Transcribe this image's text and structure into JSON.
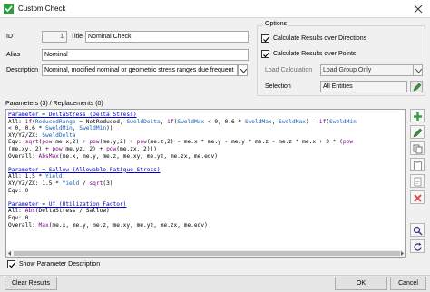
{
  "window": {
    "title": "Custom Check",
    "colors": {
      "accent": "#2e7d32",
      "icon": "#2e9e3e"
    }
  },
  "form": {
    "id_label": "ID",
    "id_value": "1",
    "title_label": "Title",
    "title_value": "Nominal Check",
    "alias_label": "Alias",
    "alias_value": "Nominal",
    "description_label": "Description",
    "description_value": "Nominal, modified nominal or geometric stress ranges due frequent"
  },
  "options": {
    "group_title": "Options",
    "calc_directions_label": "Calculate Results over Directions",
    "calc_directions_checked": true,
    "calc_points_label": "Calculate Results over Points",
    "calc_points_checked": true,
    "load_calc_label": "Load Calculation",
    "load_calc_value": "Load Group Only",
    "selection_label": "Selection",
    "selection_value": "All Entities"
  },
  "parameters": {
    "header": "Parameters (3) / Replacements (0)",
    "code_lines": [
      [
        {
          "t": "Parameter = DeltaStress (Delta Stress)",
          "c": "k-head"
        }
      ],
      [
        {
          "t": "All: "
        },
        {
          "t": "if",
          "c": "k-fn"
        },
        {
          "t": "("
        },
        {
          "t": "ReducedRange",
          "c": "k-var"
        },
        {
          "t": " = "
        },
        {
          "t": "NotReduced",
          "c": ""
        },
        {
          "t": ", "
        },
        {
          "t": "SweldDelta",
          "c": "k-var"
        },
        {
          "t": ", "
        },
        {
          "t": "if",
          "c": "k-fn"
        },
        {
          "t": "("
        },
        {
          "t": "SweldMax",
          "c": "k-var"
        },
        {
          "t": " < 0, 0.6 * "
        },
        {
          "t": "SweldMax",
          "c": "k-var"
        },
        {
          "t": ", "
        },
        {
          "t": "SweldMax",
          "c": "k-var"
        },
        {
          "t": ") - "
        },
        {
          "t": "if",
          "c": "k-fn"
        },
        {
          "t": "("
        },
        {
          "t": "SweldMin",
          "c": "k-var"
        }
      ],
      [
        {
          "t": "< 0, 0.6 * "
        },
        {
          "t": "SweldMin",
          "c": "k-var"
        },
        {
          "t": ", "
        },
        {
          "t": "SweldMin",
          "c": "k-var"
        },
        {
          "t": "))"
        }
      ],
      [
        {
          "t": "XY/YZ/ZX: "
        },
        {
          "t": "SweldDelta",
          "c": "k-var"
        }
      ],
      [
        {
          "t": "Eqv: "
        },
        {
          "t": "sqrt",
          "c": "k-fn"
        },
        {
          "t": "("
        },
        {
          "t": "pow",
          "c": "k-fn"
        },
        {
          "t": "(me.x,2) + "
        },
        {
          "t": "pow",
          "c": "k-fn"
        },
        {
          "t": "(me.y,2) + "
        },
        {
          "t": "pow",
          "c": "k-fn"
        },
        {
          "t": "(me.z,2) - me.x * me.y - me.y * me.z - me.z * me.x + 3 * ("
        },
        {
          "t": "pow",
          "c": "k-fn"
        }
      ],
      [
        {
          "t": "(me.xy, 2) + "
        },
        {
          "t": "pow",
          "c": "k-fn"
        },
        {
          "t": "(me.yz, 2) + "
        },
        {
          "t": "pow",
          "c": "k-fn"
        },
        {
          "t": "(me.zx, 2)))"
        }
      ],
      [
        {
          "t": "Overall: "
        },
        {
          "t": "AbsMax",
          "c": "k-fn"
        },
        {
          "t": "(me.x, me.y, me.z, me.xy, me.yz, me.zx, me.eqv)"
        }
      ],
      [
        {
          "t": ""
        }
      ],
      [
        {
          "t": "Parameter = Sallow (Allowable Fatigue Stress)",
          "c": "k-head"
        }
      ],
      [
        {
          "t": "All: 1.5 * "
        },
        {
          "t": "Yield",
          "c": "k-var"
        }
      ],
      [
        {
          "t": "XY/YZ/ZX: 1.5 * "
        },
        {
          "t": "Yield",
          "c": "k-var"
        },
        {
          "t": " / "
        },
        {
          "t": "sqrt",
          "c": "k-fn"
        },
        {
          "t": "(3)"
        }
      ],
      [
        {
          "t": "Eqv: 0"
        }
      ],
      [
        {
          "t": ""
        }
      ],
      [
        {
          "t": "Parameter = Uf (Utilization Factor)",
          "c": "k-head"
        }
      ],
      [
        {
          "t": "All: "
        },
        {
          "t": "Abs",
          "c": "k-fn"
        },
        {
          "t": "(DeltaStress / Sallow)"
        }
      ],
      [
        {
          "t": "Eqv: 0"
        }
      ],
      [
        {
          "t": "Overall: "
        },
        {
          "t": "Max",
          "c": "k-fn"
        },
        {
          "t": "(me.x, me.y, me.z, me.xy, me.yz, me.zx, me.eqv)"
        }
      ]
    ]
  },
  "footer": {
    "show_description_label": "Show Parameter Description",
    "show_description_checked": true,
    "clear_results_label": "Clear Results",
    "ok_label": "OK",
    "cancel_label": "Cancel"
  }
}
